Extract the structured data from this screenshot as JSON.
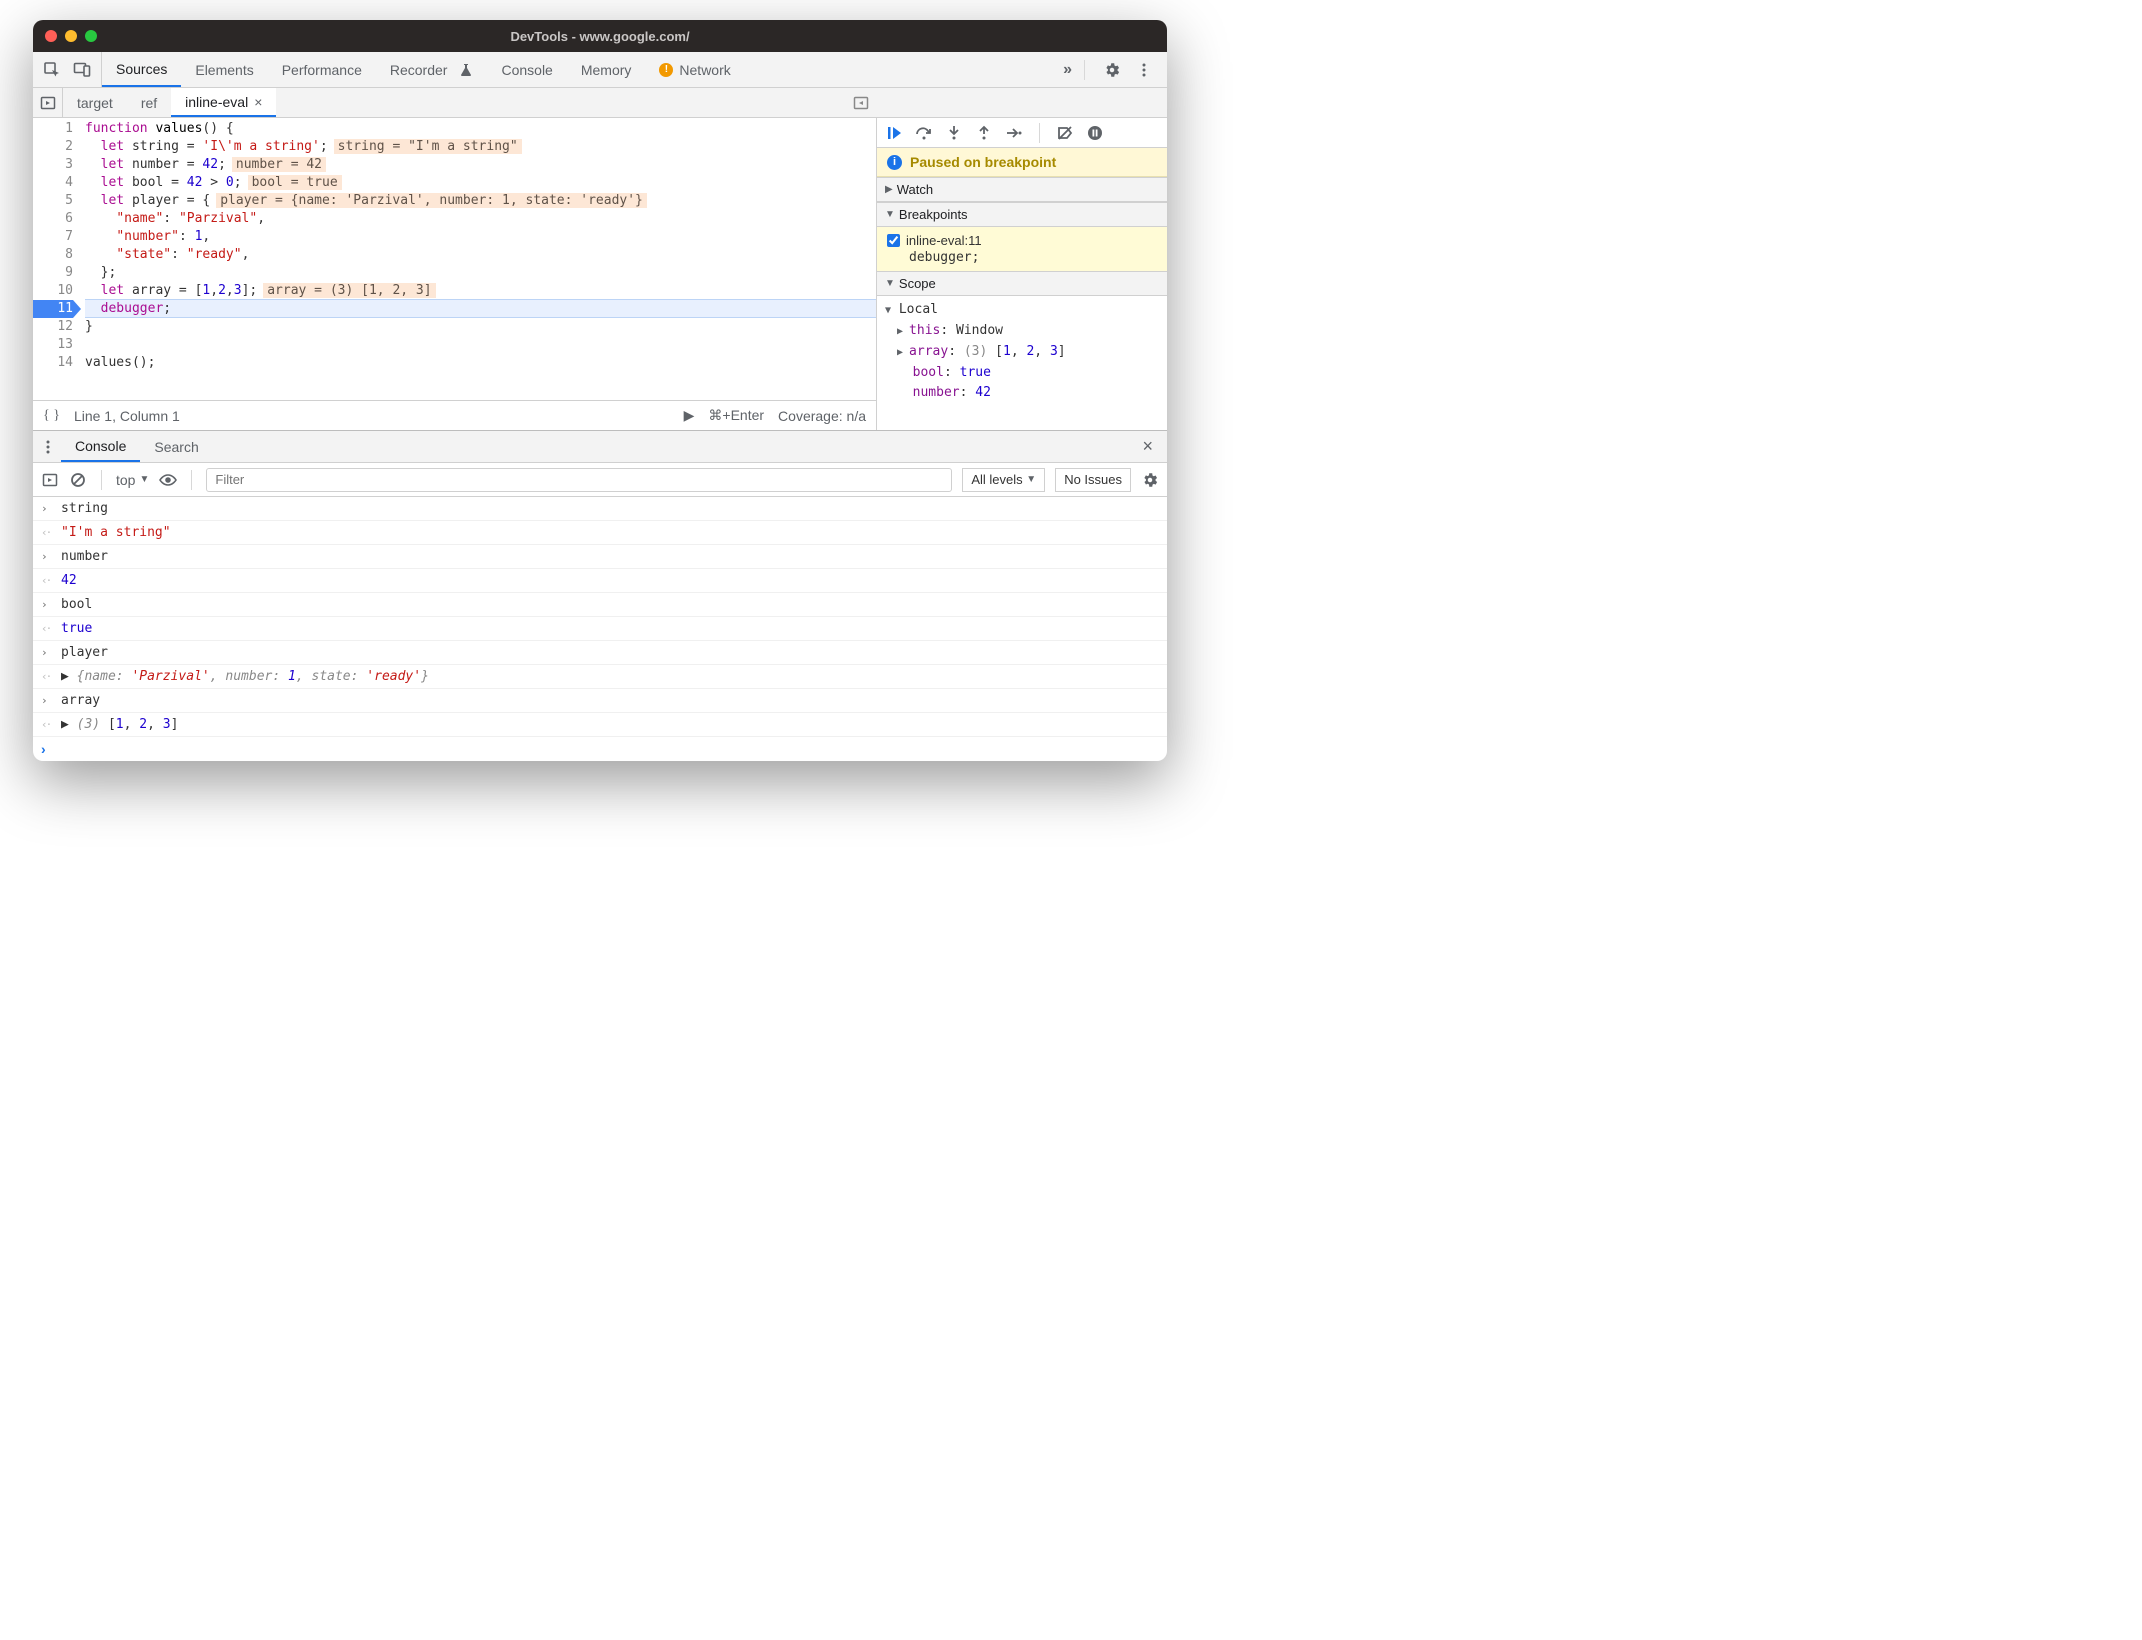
{
  "window": {
    "title": "DevTools - www.google.com/"
  },
  "main_tabs": [
    "Sources",
    "Elements",
    "Performance",
    "Recorder",
    "Console",
    "Memory",
    "Network"
  ],
  "main_tabs_active": 0,
  "network_warning": true,
  "file_tabs": [
    {
      "label": "target"
    },
    {
      "label": "ref"
    },
    {
      "label": "inline-eval",
      "active": true,
      "closeable": true
    }
  ],
  "code_lines": [
    {
      "n": 1,
      "html": "<span class='kw'>function</span> <span class='fn'>values</span>() {"
    },
    {
      "n": 2,
      "html": "  <span class='kw'>let</span> string = <span class='str'>'I\\'m a string'</span>;",
      "eval": "string = \"I'm a string\""
    },
    {
      "n": 3,
      "html": "  <span class='kw'>let</span> number = <span class='num'>42</span>;",
      "eval": "number = 42"
    },
    {
      "n": 4,
      "html": "  <span class='kw'>let</span> bool = <span class='num'>42</span> > <span class='num'>0</span>;",
      "eval": "bool = true"
    },
    {
      "n": 5,
      "html": "  <span class='kw'>let</span> player = {",
      "eval": "player = {name: 'Parzival', number: 1, state: 'ready'}"
    },
    {
      "n": 6,
      "html": "    <span class='prop'>\"name\"</span>: <span class='str'>\"Parzival\"</span>,"
    },
    {
      "n": 7,
      "html": "    <span class='prop'>\"number\"</span>: <span class='num'>1</span>,"
    },
    {
      "n": 8,
      "html": "    <span class='prop'>\"state\"</span>: <span class='str'>\"ready\"</span>,"
    },
    {
      "n": 9,
      "html": "  };"
    },
    {
      "n": 10,
      "html": "  <span class='kw'>let</span> array = [<span class='num'>1</span>,<span class='num'>2</span>,<span class='num'>3</span>];",
      "eval": "array = (3) [1, 2, 3]"
    },
    {
      "n": 11,
      "html": "  <span class='kw'>debugger</span>;",
      "bp": true,
      "highlight": true
    },
    {
      "n": 12,
      "html": "}"
    },
    {
      "n": 13,
      "html": ""
    },
    {
      "n": 14,
      "html": "values();"
    }
  ],
  "editor_footer": {
    "cursor": "Line 1, Column 1",
    "run_hint": "⌘+Enter",
    "coverage": "Coverage: n/a"
  },
  "debugger": {
    "paused_label": "Paused on breakpoint",
    "sections": {
      "watch": "Watch",
      "breakpoints": "Breakpoints",
      "scope": "Scope"
    },
    "breakpoint": {
      "file": "inline-eval:11",
      "code": "debugger;",
      "checked": true
    },
    "scope": {
      "header": "Local",
      "rows": [
        {
          "k": "this",
          "v": "Window",
          "expandable": true
        },
        {
          "k": "array",
          "v": "(3) [1, 2, 3]",
          "expandable": true,
          "arr": true
        },
        {
          "k": "bool",
          "v": "true",
          "blue": true
        },
        {
          "k": "number",
          "v": "42",
          "blue": true
        }
      ]
    }
  },
  "drawer": {
    "tabs": [
      "Console",
      "Search"
    ],
    "active": 0,
    "context": "top",
    "filter_placeholder": "Filter",
    "levels": "All levels",
    "issues": "No Issues",
    "entries": [
      {
        "dir": "in",
        "text": "string"
      },
      {
        "dir": "out",
        "html": "<span class='cval-str'>\"I'm a string\"</span>"
      },
      {
        "dir": "in",
        "text": "number"
      },
      {
        "dir": "out",
        "html": "<span class='cval-num'>42</span>"
      },
      {
        "dir": "in",
        "text": "bool"
      },
      {
        "dir": "out",
        "html": "<span class='cval-num'>true</span>"
      },
      {
        "dir": "in",
        "text": "player"
      },
      {
        "dir": "out",
        "html": "▶ <span class='cval-obj'>{<span class='k'>name</span>: <span class='s'>'Parzival'</span>, <span class='k'>number</span>: <span class='n'>1</span>, <span class='k'>state</span>: <span class='s'>'ready'</span>}</span>"
      },
      {
        "dir": "in",
        "text": "array"
      },
      {
        "dir": "out",
        "html": "▶ <span class='cval-obj'>(3) </span>[<span class='cval-num'>1</span>, <span class='cval-num'>2</span>, <span class='cval-num'>3</span>]"
      }
    ]
  }
}
